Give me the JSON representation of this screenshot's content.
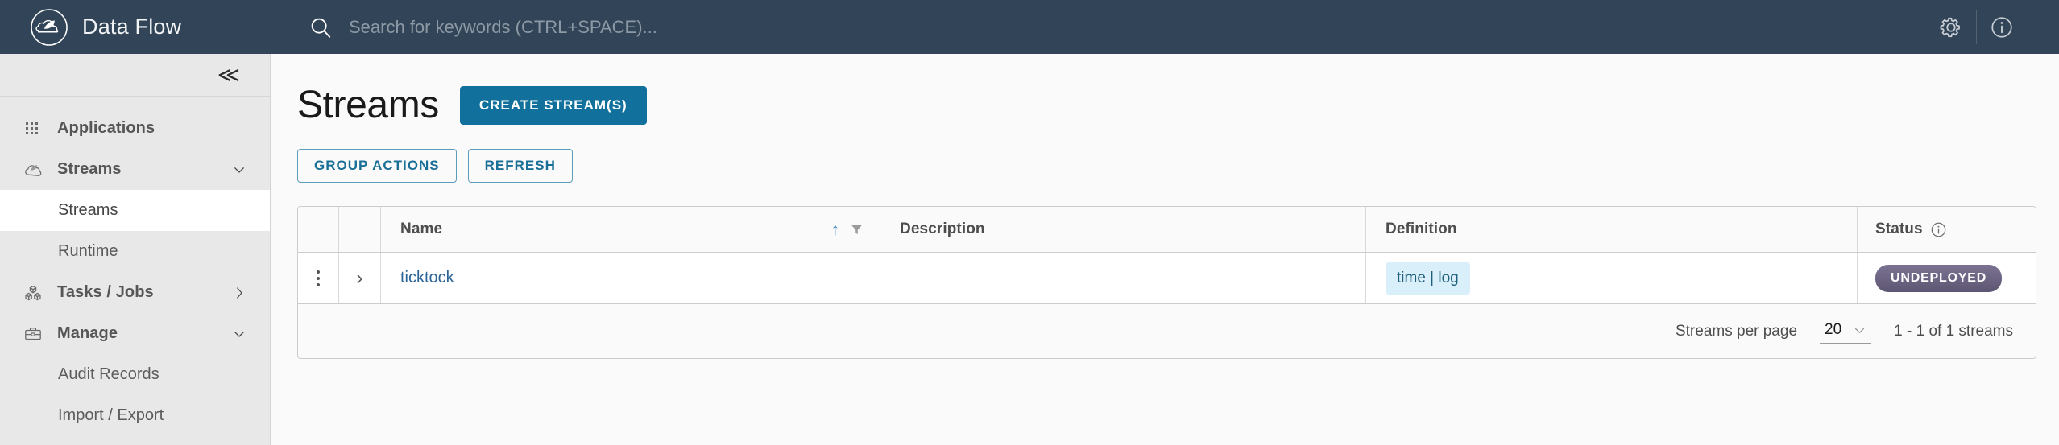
{
  "header": {
    "brand_title": "Data Flow",
    "logo_icon": "spring-cloud-dataflow-logo",
    "search": {
      "icon": "search-icon",
      "placeholder": "Search for keywords (CTRL+SPACE)...",
      "value": ""
    },
    "actions": [
      {
        "icon": "gear-icon",
        "name": "settings-button"
      },
      {
        "icon": "info-circle-icon",
        "name": "about-button"
      }
    ]
  },
  "sidebar": {
    "collapse_icon": "double-chevron-left-icon",
    "items": [
      {
        "label": "Applications",
        "icon": "grid-dots-icon",
        "type": "group",
        "caret": "",
        "active": false
      },
      {
        "label": "Streams",
        "icon": "cloud-icon",
        "type": "group",
        "caret": "chevron-down-icon",
        "active": false
      },
      {
        "label": "Streams",
        "icon": "",
        "type": "sub",
        "caret": "",
        "active": true
      },
      {
        "label": "Runtime",
        "icon": "",
        "type": "sub",
        "caret": "",
        "active": false
      },
      {
        "label": "Tasks / Jobs",
        "icon": "boxes-icon",
        "type": "group",
        "caret": "chevron-right-icon",
        "active": false
      },
      {
        "label": "Manage",
        "icon": "briefcase-icon",
        "type": "group",
        "caret": "chevron-down-icon",
        "active": false
      },
      {
        "label": "Audit Records",
        "icon": "",
        "type": "sub",
        "caret": "",
        "active": false
      },
      {
        "label": "Import / Export",
        "icon": "",
        "type": "sub",
        "caret": "",
        "active": false
      }
    ]
  },
  "main": {
    "page_title": "Streams",
    "create_button": "CREATE STREAM(S)",
    "group_actions_button": "GROUP ACTIONS",
    "refresh_button": "REFRESH",
    "table": {
      "columns": {
        "name": "Name",
        "description": "Description",
        "definition": "Definition",
        "status": "Status"
      },
      "name_sort_icon": "sort-ascending-icon",
      "name_filter_icon": "filter-icon",
      "status_info_icon": "info-circle-icon",
      "rows": [
        {
          "menu_icon": "kebab-menu-icon",
          "expand_icon": "chevron-right-icon",
          "name": "ticktock",
          "description": "",
          "definition": "time | log",
          "status": "UNDEPLOYED"
        }
      ]
    },
    "footer": {
      "per_page_label": "Streams per page",
      "per_page_value": "20",
      "per_page_caret": "chevron-down-icon",
      "count_label": "1 - 1 of 1 streams"
    }
  },
  "colors": {
    "header_bg": "#324558",
    "sidebar_bg": "#e8e8e8",
    "primary": "#11719c",
    "link": "#2a6496",
    "definition_chip_bg": "#d9f0fb",
    "status_undeployed": "#5d5672"
  }
}
